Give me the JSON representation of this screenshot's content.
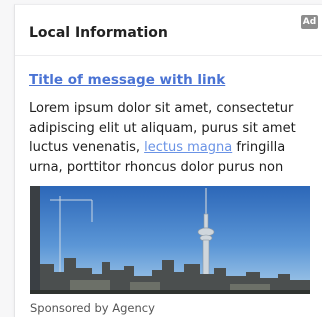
{
  "ad_badge": "Ad",
  "heading": "Local Information",
  "message": {
    "title": "Title of message with link",
    "body_part1": "Lorem ipsum dolor sit amet, consectetur adipiscing elit ut aliquam, purus sit amet luctus venenatis, ",
    "body_link": "lectus magna",
    "body_part2": " fringilla urna, porttitor rhoncus dolor purus non"
  },
  "image": {
    "subject": "city-skyline-photo"
  },
  "sponsor": "Sponsored by Agency",
  "colors": {
    "link": "#4a73d4",
    "inline_link": "#6a93e6",
    "badge": "#8d8d8d"
  }
}
